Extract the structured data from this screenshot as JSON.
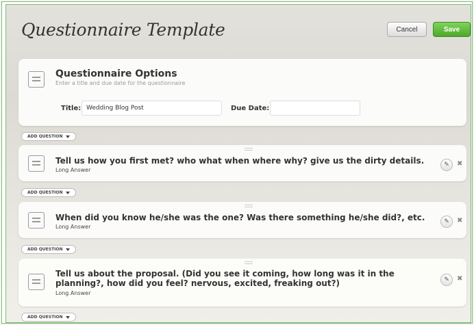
{
  "header": {
    "title": "Questionnaire Template",
    "cancel_label": "Cancel",
    "save_label": "Save"
  },
  "options": {
    "title": "Questionnaire Options",
    "subtitle": "Enter a title and due date for the questionnaire",
    "title_label": "Title:",
    "title_value": "Wedding Blog Post",
    "due_date_label": "Due Date:",
    "due_date_value": ""
  },
  "add_question_label": "ADD QUESTION",
  "questions": [
    {
      "text": "Tell us how you first met? who what when where why? give us the dirty details.",
      "type": "Long Answer"
    },
    {
      "text": "When did you know he/she was the one? Was there something he/she did?, etc.",
      "type": "Long Answer"
    },
    {
      "text": "Tell us about the proposal. (Did you see it coming, how long was it in the planning?, how did you feel? nervous, excited, freaking out?)",
      "type": "Long Answer"
    }
  ],
  "icons": {
    "document": "document-icon",
    "calendar": "calendar-icon",
    "edit": "pencil-icon",
    "delete": "close-icon"
  },
  "colors": {
    "save_button": "#4ea82a",
    "frame_border": "#7fb878"
  }
}
